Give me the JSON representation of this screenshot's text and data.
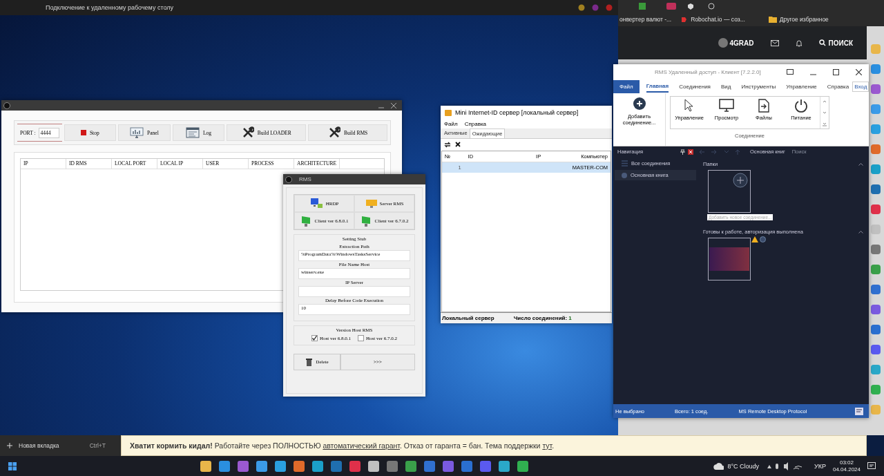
{
  "rdp_window": {
    "title": "Подключение к удаленному рабочему столу"
  },
  "browser": {
    "bookmarks": [
      {
        "label": "онвертер валют -..."
      },
      {
        "label": "Robochat.io — соз..."
      },
      {
        "label": "Другое избранное"
      }
    ],
    "site_header": {
      "username": "4GRAD",
      "search": "ПОИСК"
    }
  },
  "builder_window": {
    "port_label": "PORT :",
    "port": "4444",
    "buttons": [
      "Stop",
      "Panel",
      "Log",
      "Build LOADER",
      "Build RMS"
    ],
    "columns": [
      "IP",
      "ID RMS",
      "LOCAL PORT",
      "LOCAL IP",
      "USER",
      "PROCESS",
      "ARCHITECTURE"
    ]
  },
  "rms_dialog": {
    "title": "RMS",
    "mode_buttons": [
      "HRDP",
      "Server RMS",
      "Client ver 6.8.0.1",
      "Client ver 6.7.0.2"
    ],
    "stub_title": "Setting Stub",
    "fields": [
      {
        "label": "Extraction Path",
        "value": "%ProgramData%\\WindowsTasksService"
      },
      {
        "label": "File Name Host",
        "value": "winserv.exe"
      },
      {
        "label": "IP Server"
      },
      {
        "label": "Delay Before Code Execution",
        "value": "10"
      }
    ],
    "version_title": "Version Host RMS",
    "versions": [
      {
        "label": "Host ver 6.8.0.1",
        "checked": true
      },
      {
        "label": "Host ver 6.7.0.2",
        "checked": false
      }
    ],
    "actions": [
      "Delete",
      ">>>"
    ]
  },
  "id_server_window": {
    "title": "Mini Internet-ID сервер [локальный сервер]",
    "menu": [
      "Файл",
      "Справка"
    ],
    "tabs": [
      {
        "label": "Активные",
        "selected": false
      },
      {
        "label": "Ожидающие",
        "selected": true
      }
    ],
    "columns": [
      "№",
      "ID",
      "IP",
      "Компьютер"
    ],
    "rows": [
      {
        "number": "1",
        "computer": "MASTER-COM",
        "selected": true
      }
    ],
    "status_bar": {
      "server": "Локальный сервер",
      "count_label": "Число соединений:",
      "count": "1"
    }
  },
  "rms_client": {
    "title": "RMS Удаленный доступ - Клиент [7.2.2.0]",
    "tabs": [
      {
        "label": "Файл",
        "kind": "app-menu",
        "selected": false
      },
      {
        "label": "Главная",
        "kind": "tab",
        "selected": true
      },
      {
        "label": "Соединения",
        "kind": "tab",
        "selected": false
      },
      {
        "label": "Вид",
        "kind": "tab",
        "selected": false
      },
      {
        "label": "Инструменты",
        "kind": "tab",
        "selected": false
      },
      {
        "label": "Управление",
        "kind": "tab",
        "selected": false
      },
      {
        "label": "Справка",
        "kind": "tab",
        "selected": false
      },
      {
        "label": "Вход",
        "kind": "button",
        "selected": false
      }
    ],
    "add_button": "Добавить соединение...",
    "ribbon_actions": [
      "Управление",
      "Просмотр",
      "Файлы",
      "Питание"
    ],
    "ribbon_group": "Соединение",
    "navigation": {
      "title": "Навигация",
      "items": [
        {
          "label": "Все соединения",
          "selected": false
        },
        {
          "label": "Основная книга",
          "selected": true
        }
      ]
    },
    "breadcrumb": "Основная книг",
    "search_placeholder": "Поиск",
    "sections": [
      {
        "title": "Папки",
        "cards": [
          {
            "kind": "add",
            "caption": "Добавить новое соединение..."
          }
        ]
      },
      {
        "title": "Готовы к работе, авторизация выполнена",
        "cards": [
          {
            "kind": "screen",
            "warning": true
          }
        ]
      }
    ],
    "status_bar": [
      "Не выбрано",
      "Всего: 1 соед.",
      "MS Remote Desktop Protocol"
    ]
  },
  "browser_tab_menu": {
    "label": "Новая вкладка",
    "shortcut": "Ctrl+T"
  },
  "notice": [
    {
      "kind": "bold",
      "text": "Хватит кормить кидал!"
    },
    {
      "kind": "text",
      "text": " Работайте через ПОЛНОСТЬЮ "
    },
    {
      "kind": "link",
      "text": "автоматический гарант"
    },
    {
      "kind": "text",
      "text": ". Отказ от гаранта = бан. Тема поддержки "
    },
    {
      "kind": "link",
      "text": "тут"
    },
    {
      "kind": "text",
      "text": "."
    }
  ],
  "taskbar": {
    "weather": "8°C Cloudy",
    "language": "УКР",
    "time": "03:02",
    "date": "04.04.2024"
  }
}
